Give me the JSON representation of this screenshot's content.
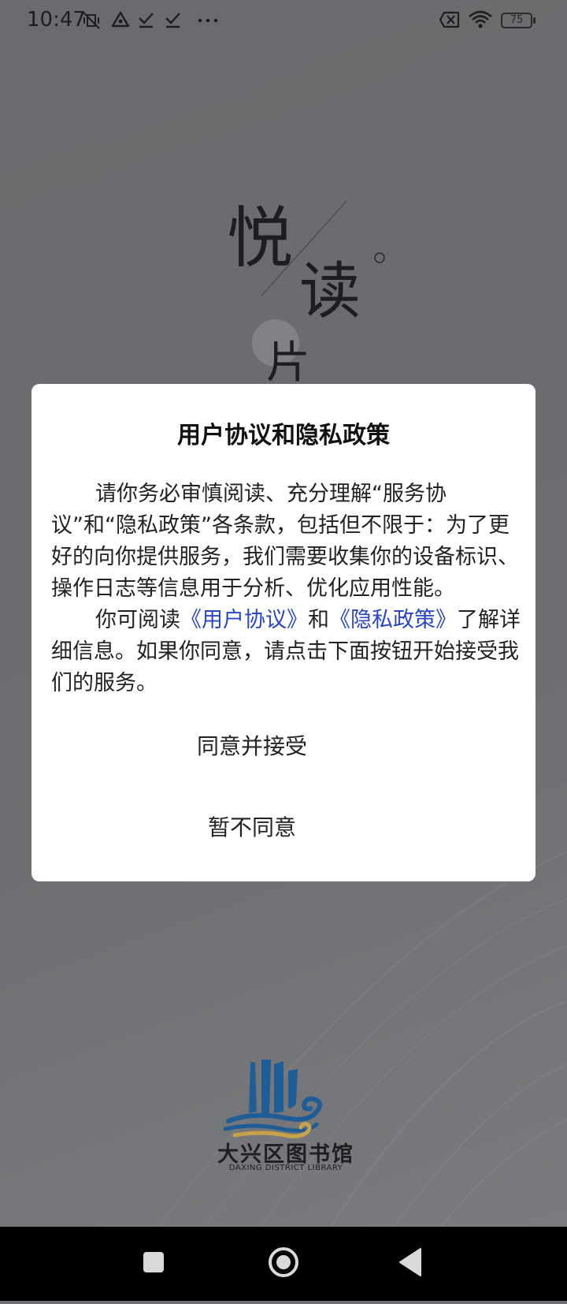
{
  "status_bar": {
    "time": "10:47",
    "icons": [
      "mute-vibrate-icon",
      "triangle-app-icon",
      "check-icon",
      "check-icon",
      "more-dots-icon",
      "sim-off-icon",
      "wifi-icon"
    ],
    "battery": "75"
  },
  "splash": {
    "chars": [
      "悦",
      "读",
      "片"
    ],
    "accent_color": "#2a45c8"
  },
  "dialog": {
    "title": "用户协议和隐私政策",
    "paragraph1": "请你务必审慎阅读、充分理解“服务协议”和“隐私政策”各条款，包括但不限于：为了更好的向你提供服务，我们需要收集你的设备标识、操作日志等信息用于分析、优化应用性能。",
    "p2_prefix": "你可阅读",
    "user_agreement_link": "《用户协议》",
    "p2_and": "和",
    "privacy_policy_link": "《隐私政策》",
    "p2_suffix": "了解详细信息。如果你同意，请点击下面按钮开始接受我们的服务。",
    "agree_button": "同意并接受",
    "disagree_button": "暂不同意"
  },
  "logo": {
    "name_cn": "大兴区图书馆",
    "name_en": "DAXING DISTRICT LIBRARY",
    "colors": {
      "blue": "#1f5d96",
      "gold": "#c8a24a"
    }
  },
  "nav_bar": {
    "buttons": [
      "recents-square-icon",
      "home-circle-icon",
      "back-triangle-icon"
    ]
  }
}
